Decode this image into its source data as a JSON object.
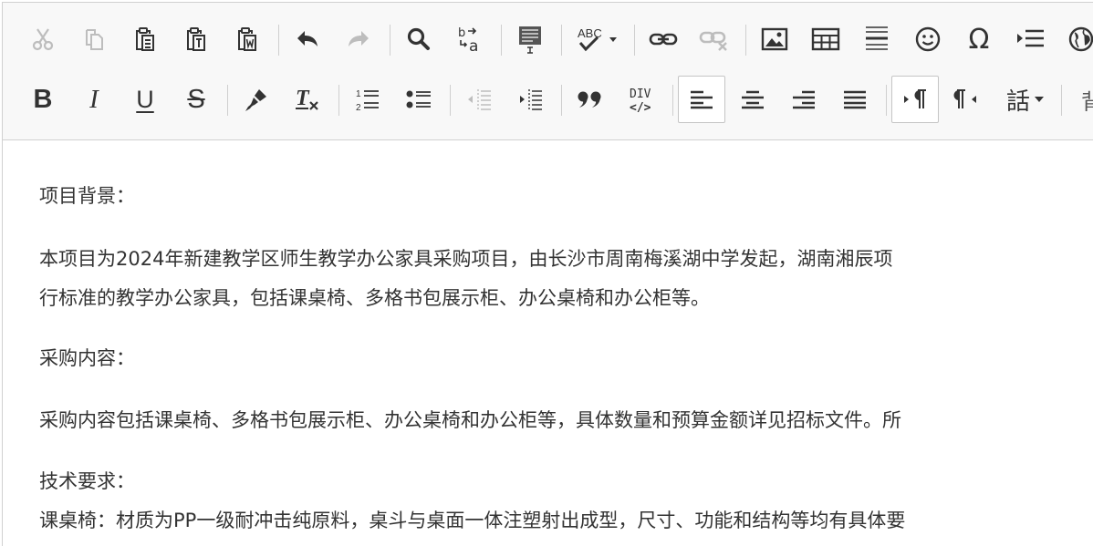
{
  "toolbar": {
    "row1": [
      {
        "name": "cut-icon",
        "disabled": true
      },
      {
        "name": "copy-icon",
        "disabled": true
      },
      {
        "name": "paste-icon"
      },
      {
        "name": "paste-text-icon"
      },
      {
        "name": "paste-from-word-icon"
      },
      {
        "name": "undo-icon"
      },
      {
        "name": "redo-icon",
        "disabled": true
      },
      {
        "name": "find-icon"
      },
      {
        "name": "replace-icon"
      },
      {
        "name": "select-all-icon"
      },
      {
        "name": "spellcheck-icon"
      },
      {
        "name": "link-icon"
      },
      {
        "name": "unlink-icon",
        "disabled": true
      },
      {
        "name": "image-icon"
      },
      {
        "name": "table-icon"
      },
      {
        "name": "horizontal-rule-icon"
      },
      {
        "name": "smiley-icon"
      },
      {
        "name": "special-char-icon"
      },
      {
        "name": "page-break-icon"
      },
      {
        "name": "iframe-icon"
      }
    ],
    "row2": [
      {
        "name": "bold-icon"
      },
      {
        "name": "italic-icon"
      },
      {
        "name": "underline-icon"
      },
      {
        "name": "strikethrough-icon"
      },
      {
        "name": "copy-format-icon"
      },
      {
        "name": "remove-format-icon"
      },
      {
        "name": "numbered-list-icon"
      },
      {
        "name": "bulleted-list-icon"
      },
      {
        "name": "decrease-indent-icon",
        "disabled": true
      },
      {
        "name": "increase-indent-icon"
      },
      {
        "name": "blockquote-icon"
      },
      {
        "name": "create-div-icon"
      },
      {
        "name": "align-left-icon",
        "active": true
      },
      {
        "name": "align-center-icon"
      },
      {
        "name": "align-right-icon"
      },
      {
        "name": "justify-icon"
      },
      {
        "name": "text-direction-ltr-icon",
        "active": true
      },
      {
        "name": "text-direction-rtl-icon"
      },
      {
        "name": "language-icon"
      }
    ],
    "labels": {
      "bold": "B",
      "italic": "I",
      "underline": "U",
      "strike": "S",
      "remove_format": "T",
      "omega": "Ω",
      "language": "話",
      "div_top": "DIV",
      "div_bottom": "</>",
      "abc": "ABC"
    }
  },
  "content": {
    "p1": "项目背景：",
    "p2_line1": "本项目为2024年新建教学区师生教学办公家具采购项目，由长沙市周南梅溪湖中学发起，湖南湘辰项",
    "p2_line2": "行标准的教学办公家具，包括课桌椅、多格书包展示柜、办公桌椅和办公柜等。",
    "p3": "采购内容：",
    "p4": "采购内容包括课桌椅、多格书包展示柜、办公桌椅和办公柜等，具体数量和预算金额详见招标文件。所",
    "p5": "技术要求：",
    "p6": "课桌椅：材质为PP一级耐冲击纯原料，桌斗与桌面一体注塑射出成型，尺寸、功能和结构等均有具体要"
  },
  "colors": {
    "toolbar_bg": "#f8f8f8",
    "icon": "#333333",
    "icon_disabled": "#bdbdbd",
    "border": "#d1d1d1"
  }
}
